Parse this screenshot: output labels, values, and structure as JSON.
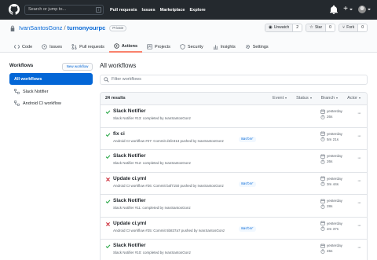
{
  "header": {
    "search_placeholder": "Search or jump to...",
    "search_shortcut": "/",
    "nav": [
      "Pull requests",
      "Issues",
      "Marketplace",
      "Explore"
    ],
    "plus": "+"
  },
  "repo": {
    "owner": "IvanSantosGonz",
    "separator": "/",
    "name": "turnonyourpc",
    "visibility": "Private",
    "unwatch_label": "Unwatch",
    "unwatch_count": "2",
    "star_label": "Star",
    "star_count": "0",
    "fork_label": "Fork",
    "fork_count": "0"
  },
  "tabs": [
    {
      "label": "Code",
      "icon": "code-icon"
    },
    {
      "label": "Issues",
      "icon": "issue-icon"
    },
    {
      "label": "Pull requests",
      "icon": "pull-request-icon"
    },
    {
      "label": "Actions",
      "icon": "play-icon"
    },
    {
      "label": "Projects",
      "icon": "project-icon"
    },
    {
      "label": "Security",
      "icon": "shield-icon"
    },
    {
      "label": "Insights",
      "icon": "graph-icon"
    },
    {
      "label": "Settings",
      "icon": "gear-icon"
    }
  ],
  "sidebar": {
    "title": "Workflows",
    "new_button": "New workflow",
    "items": [
      {
        "label": "All workflows"
      },
      {
        "label": "Slack Notifier"
      },
      {
        "label": "Android CI workflow"
      }
    ]
  },
  "main": {
    "title": "All workflows",
    "filter_placeholder": "Filter workflows",
    "results": "24 results",
    "filters": [
      "Event",
      "Status",
      "Branch",
      "Actor"
    ]
  },
  "runs": [
    {
      "status": "success",
      "title": "Slack Notifier",
      "meta": "Slack Notifier #13: completed by IvanSantosGonz",
      "branch": "",
      "date": "yesterday",
      "duration": "26s"
    },
    {
      "status": "success",
      "title": "fix ci",
      "meta": "Android CI workflow #27: Commit d1fe313 pushed by IvanSantosGonz",
      "branch": "master",
      "date": "yesterday",
      "duration": "5m 21s"
    },
    {
      "status": "success",
      "title": "Slack Notifier",
      "meta": "Slack Notifier #12: completed by IvanSantosGonz",
      "branch": "",
      "date": "yesterday",
      "duration": "26s"
    },
    {
      "status": "failure",
      "title": "Update ci.yml",
      "meta": "Android CI workflow #26: Commit baf7150 pushed by IvanSantosGonz",
      "branch": "master",
      "date": "yesterday",
      "duration": "3m 44s"
    },
    {
      "status": "success",
      "title": "Slack Notifier",
      "meta": "Slack Notifier #11: completed by IvanSantosGonz",
      "branch": "",
      "date": "yesterday",
      "duration": "28s"
    },
    {
      "status": "failure",
      "title": "Update ci.yml",
      "meta": "Android CI workflow #25: Commit 5b837a7 pushed by IvanSantosGonz",
      "branch": "master",
      "date": "yesterday",
      "duration": "2m 37s"
    },
    {
      "status": "success",
      "title": "Slack Notifier",
      "meta": "Slack Notifier #10: completed by IvanSantosGonz",
      "branch": "",
      "date": "yesterday",
      "duration": "45s"
    }
  ],
  "colors": {
    "header_bg": "#24292e",
    "link": "#0366d6",
    "success": "#28a745",
    "failure": "#cb2431",
    "active_tab": "#f9826c"
  }
}
